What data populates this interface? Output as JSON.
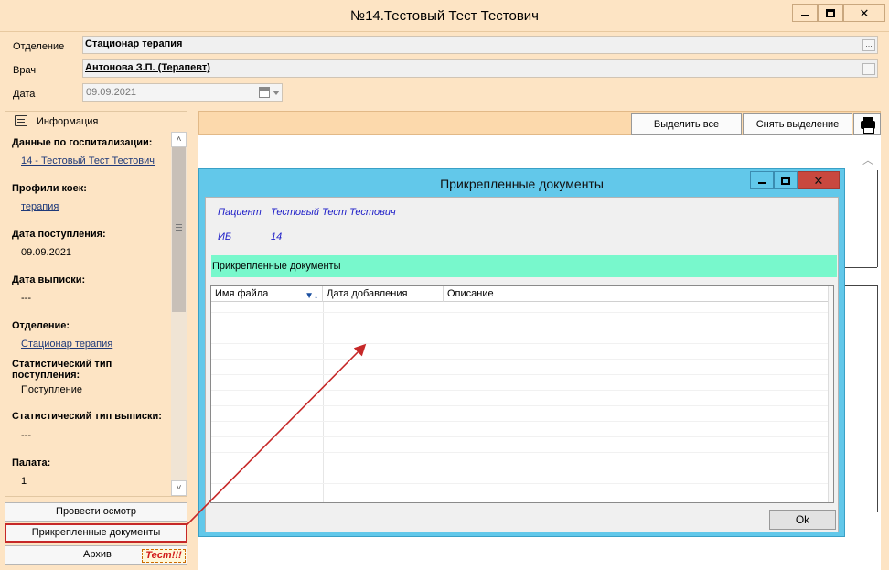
{
  "window": {
    "title": "№14.Тестовый Тест Тестович"
  },
  "form": {
    "department_label": "Отделение",
    "department_value": "Стационар  терапия",
    "doctor_label": "Врач",
    "doctor_value": "Антонова  З.П. (Терапевт)",
    "date_label": "Дата",
    "date_value": "09.09.2021",
    "lookup_button": "..."
  },
  "info_panel": {
    "header": "Информация",
    "sections": [
      {
        "heading": "Данные по госпитализации:",
        "value": "14 - Тестовый Тест Тестович",
        "link": true
      },
      {
        "heading": "Профили коек:",
        "value": "терапия",
        "link": true
      },
      {
        "heading": "Дата поступления:",
        "value": "09.09.2021",
        "link": false
      },
      {
        "heading": "Дата выписки:",
        "value": "---",
        "link": false
      },
      {
        "heading": "Отделение:",
        "value": "Стационар  терапия",
        "link": true
      },
      {
        "heading": "Статистический тип поступления:",
        "value": "Поступление",
        "link": false
      },
      {
        "heading": "Статистический тип выписки:",
        "value": "---",
        "link": false
      },
      {
        "heading": "Палата:",
        "value": "1",
        "link": false
      }
    ],
    "scroll_up": "˄",
    "scroll_down": "˅"
  },
  "left_buttons": {
    "exam": "Провести осмотр",
    "attached_docs": "Прикрепленные документы",
    "archive": "Архив",
    "test_badge": "Тест!!!"
  },
  "toolbar": {
    "select_all": "Выделить все",
    "deselect": "Снять выделение"
  },
  "dialog": {
    "title": "Прикрепленные документы",
    "patient_label": "Пациент",
    "patient_value": "Тестовый Тест Тестович",
    "ib_label": "ИБ",
    "ib_value": "14",
    "section_title": "Прикрепленные документы",
    "columns": [
      "Имя файла",
      "Дата добавления",
      "Описание"
    ],
    "rows": [],
    "ok_label": "Ok"
  },
  "icons": {
    "minimize": "minimize-icon",
    "maximize": "maximize-icon",
    "close": "close-icon",
    "info": "document-edit-icon",
    "print": "printer-icon",
    "calendar": "calendar-icon",
    "sort": "sort-filter-icon"
  },
  "colors": {
    "window_bg": "#fde4c4",
    "dialog_bg": "#62c8ea",
    "section_header": "#78f8cc",
    "close_button": "#c9483f",
    "annotation": "#c62828"
  }
}
